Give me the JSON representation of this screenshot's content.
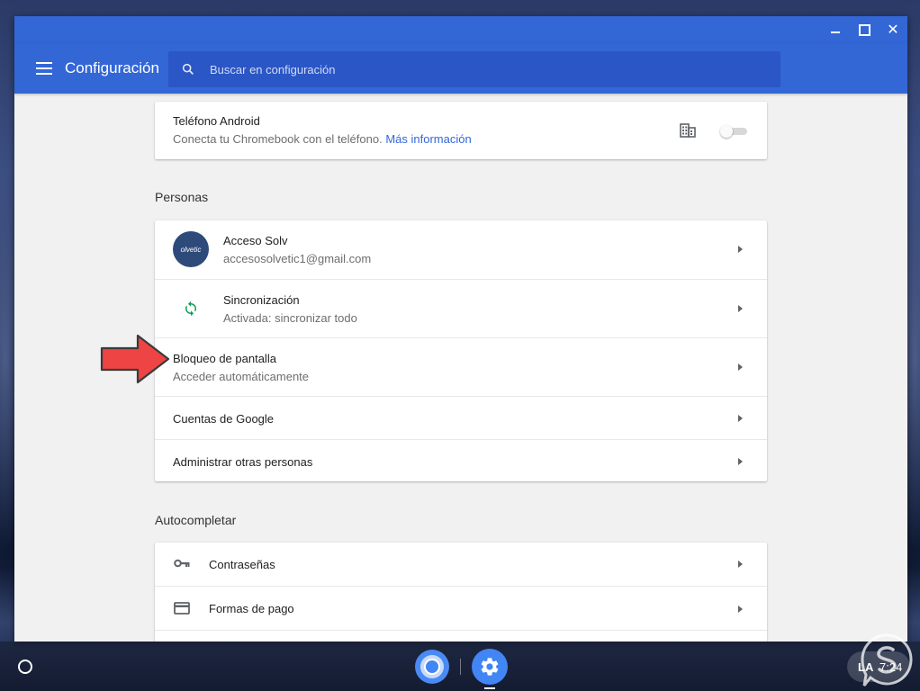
{
  "window": {
    "controls": {
      "minimize": "minimize",
      "maximize": "maximize",
      "close": "✕"
    }
  },
  "toolbar": {
    "title": "Configuración",
    "search_placeholder": "Buscar en configuración"
  },
  "android_card": {
    "title": "Teléfono Android",
    "description": "Conecta tu Chromebook con el teléfono.",
    "link": "Más información",
    "toggle_on": false
  },
  "personas": {
    "section_title": "Personas",
    "items": [
      {
        "label": "Acceso Solv",
        "sublabel": "accesosolvetic1@gmail.com",
        "avatar_text": "olvetic"
      },
      {
        "label": "Sincronización",
        "sublabel": "Activada: sincronizar todo"
      },
      {
        "label": "Bloqueo de pantalla",
        "sublabel": "Acceder automáticamente"
      },
      {
        "label": "Cuentas de Google"
      },
      {
        "label": "Administrar otras personas"
      }
    ]
  },
  "autocompletar": {
    "section_title": "Autocompletar",
    "items": [
      {
        "label": "Contraseñas",
        "icon": "key-icon"
      },
      {
        "label": "Formas de pago",
        "icon": "credit-card-icon"
      }
    ]
  },
  "shelf": {
    "apps": [
      "chrome-icon",
      "settings-icon"
    ],
    "language": "LA",
    "time": "7:24"
  },
  "colors": {
    "header_blue": "#3367d6",
    "search_blue": "#2a56c6",
    "link_blue": "#3367d6",
    "sync_green": "#0f9d58",
    "arrow_red": "#ef4444"
  }
}
